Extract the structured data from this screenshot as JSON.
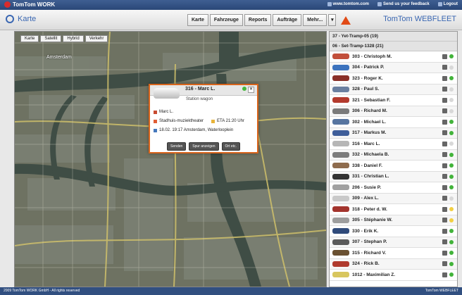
{
  "brand": {
    "name": "TomTom WORK"
  },
  "top_links": [
    "www.tomtom.com",
    "Send us your feedback",
    "Logout"
  ],
  "header": {
    "page": "Karte",
    "product": "TomTom WEBFLEET"
  },
  "tabs": [
    "Karte",
    "Fahrzeuge",
    "Reports",
    "Aufträge",
    "Mehr..."
  ],
  "map": {
    "tools": [
      "Karte",
      "Satellit",
      "Hybrid",
      "Verkehr"
    ],
    "place": "Amsterdam"
  },
  "popup": {
    "title": "316 - Marc L.",
    "subtitle": "Station wagon",
    "driver": "Marc L.",
    "destination": "Stadhuis-muziektheater",
    "eta": "ETA 21:20 Uhr",
    "location": "18.02. 19:17 Amsterdam, Waterlooplein",
    "actions": [
      "Senden",
      "Spur anzeigen",
      "Ort etc."
    ]
  },
  "groups": [
    {
      "label": "37 - Yet-Tramp-05 (19)"
    },
    {
      "label": "06 - Set-Tramp-1328 (21)"
    }
  ],
  "vehicles": [
    {
      "label": "303 - Christoph M.",
      "status": "green",
      "color": "#c24f3b"
    },
    {
      "label": "304 - Patrick P.",
      "status": "gray",
      "color": "#3c73be"
    },
    {
      "label": "323 - Roger K.",
      "status": "green",
      "color": "#8a2f27"
    },
    {
      "label": "328 - Paul S.",
      "status": "gray",
      "color": "#6a7fa0"
    },
    {
      "label": "321 - Sebastian F.",
      "status": "gray",
      "color": "#b33a2d"
    },
    {
      "label": "306 - Richard M.",
      "status": "gray",
      "color": "#7a7a7a"
    },
    {
      "label": "302 - Michael L.",
      "status": "green",
      "color": "#5775a0"
    },
    {
      "label": "317 - Markus M.",
      "status": "green",
      "color": "#3f5e9a"
    },
    {
      "label": "316 - Marc L.",
      "status": "gray",
      "color": "#b6b6b6"
    },
    {
      "label": "332 - Michaela B.",
      "status": "green",
      "color": "#7c7c7c"
    },
    {
      "label": "338 - Daniel F.",
      "status": "green",
      "color": "#8e6b4d"
    },
    {
      "label": "331 - Christian L.",
      "status": "green",
      "color": "#333333"
    },
    {
      "label": "206 - Susie P.",
      "status": "green",
      "color": "#a0a0a0"
    },
    {
      "label": "309 - Alex L.",
      "status": "gray",
      "color": "#c9c9c9"
    },
    {
      "label": "318 - Peter d. W.",
      "status": "yellow",
      "color": "#a3342d"
    },
    {
      "label": "305 - Stéphanie W.",
      "status": "yellow",
      "color": "#9d9d9d"
    },
    {
      "label": "330 - Erik K.",
      "status": "green",
      "color": "#2f4a7a"
    },
    {
      "label": "307 - Stephan P.",
      "status": "green",
      "color": "#5a5a5a"
    },
    {
      "label": "315 - Richard V.",
      "status": "green",
      "color": "#6a5031"
    },
    {
      "label": "324 - Rick B.",
      "status": "green",
      "color": "#b03a2d"
    },
    {
      "label": "1012 - Maximilian Z.",
      "status": "green",
      "color": "#d8c65e"
    }
  ],
  "footer": {
    "left": "2009 TomTom WORK GmbH - All rights reserved",
    "right": "TomTom WEBFLEET"
  }
}
